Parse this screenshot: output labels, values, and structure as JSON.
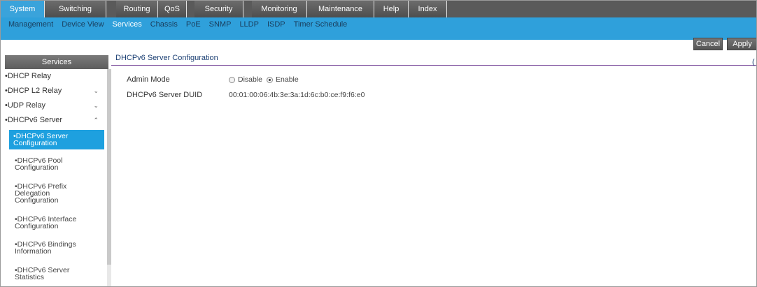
{
  "top_nav": [
    {
      "label": "System",
      "active": true
    },
    {
      "label": "Switching",
      "active": false
    },
    {
      "label": "Routing",
      "active": false
    },
    {
      "label": "QoS",
      "active": false
    },
    {
      "label": "Security",
      "active": false
    },
    {
      "label": "Monitoring",
      "active": false
    },
    {
      "label": "Maintenance",
      "active": false
    },
    {
      "label": "Help",
      "active": false
    },
    {
      "label": "Index",
      "active": false
    }
  ],
  "sub_nav": [
    {
      "label": "Management",
      "active": false
    },
    {
      "label": "Device View",
      "active": false
    },
    {
      "label": "Services",
      "active": true
    },
    {
      "label": "Chassis",
      "active": false
    },
    {
      "label": "PoE",
      "active": false
    },
    {
      "label": "SNMP",
      "active": false
    },
    {
      "label": "LLDP",
      "active": false
    },
    {
      "label": "ISDP",
      "active": false
    },
    {
      "label": "Timer Schedule",
      "active": false
    }
  ],
  "buttons": {
    "cancel": "Cancel",
    "apply": "Apply"
  },
  "sidebar": {
    "title": "Services",
    "items": [
      {
        "label": "•DHCP Relay",
        "chevron": ""
      },
      {
        "label": "•DHCP L2 Relay",
        "chevron": "⌄"
      },
      {
        "label": "•UDP Relay",
        "chevron": "⌄"
      },
      {
        "label": "•DHCPv6 Server",
        "chevron": "⌃"
      }
    ],
    "subitems": [
      {
        "label": "•DHCPv6 Server Configuration",
        "active": true
      },
      {
        "label": "•DHCPv6 Pool Configuration",
        "active": false
      },
      {
        "label": "•DHCPv6 Prefix Delegation Configuration",
        "active": false
      },
      {
        "label": "•DHCPv6 Interface Configuration",
        "active": false
      },
      {
        "label": "•DHCPv6 Bindings Information",
        "active": false
      },
      {
        "label": "•DHCPv6 Server Statistics",
        "active": false
      }
    ]
  },
  "content": {
    "title": "DHCPv6 Server Configuration",
    "help": "(",
    "admin_mode_label": "Admin Mode",
    "admin_mode_options": {
      "disable": "Disable",
      "enable": "Enable",
      "selected": "enable"
    },
    "duid_label": "DHCPv6 Server DUID",
    "duid_value": "00:01:00:06:4b:3e:3a:1d:6c:b0:ce:f9:f6:e0"
  },
  "colors": {
    "accent": "#2fa0db",
    "nav_bg": "#5a5a5a",
    "title_rule": "#7a4b9b"
  }
}
